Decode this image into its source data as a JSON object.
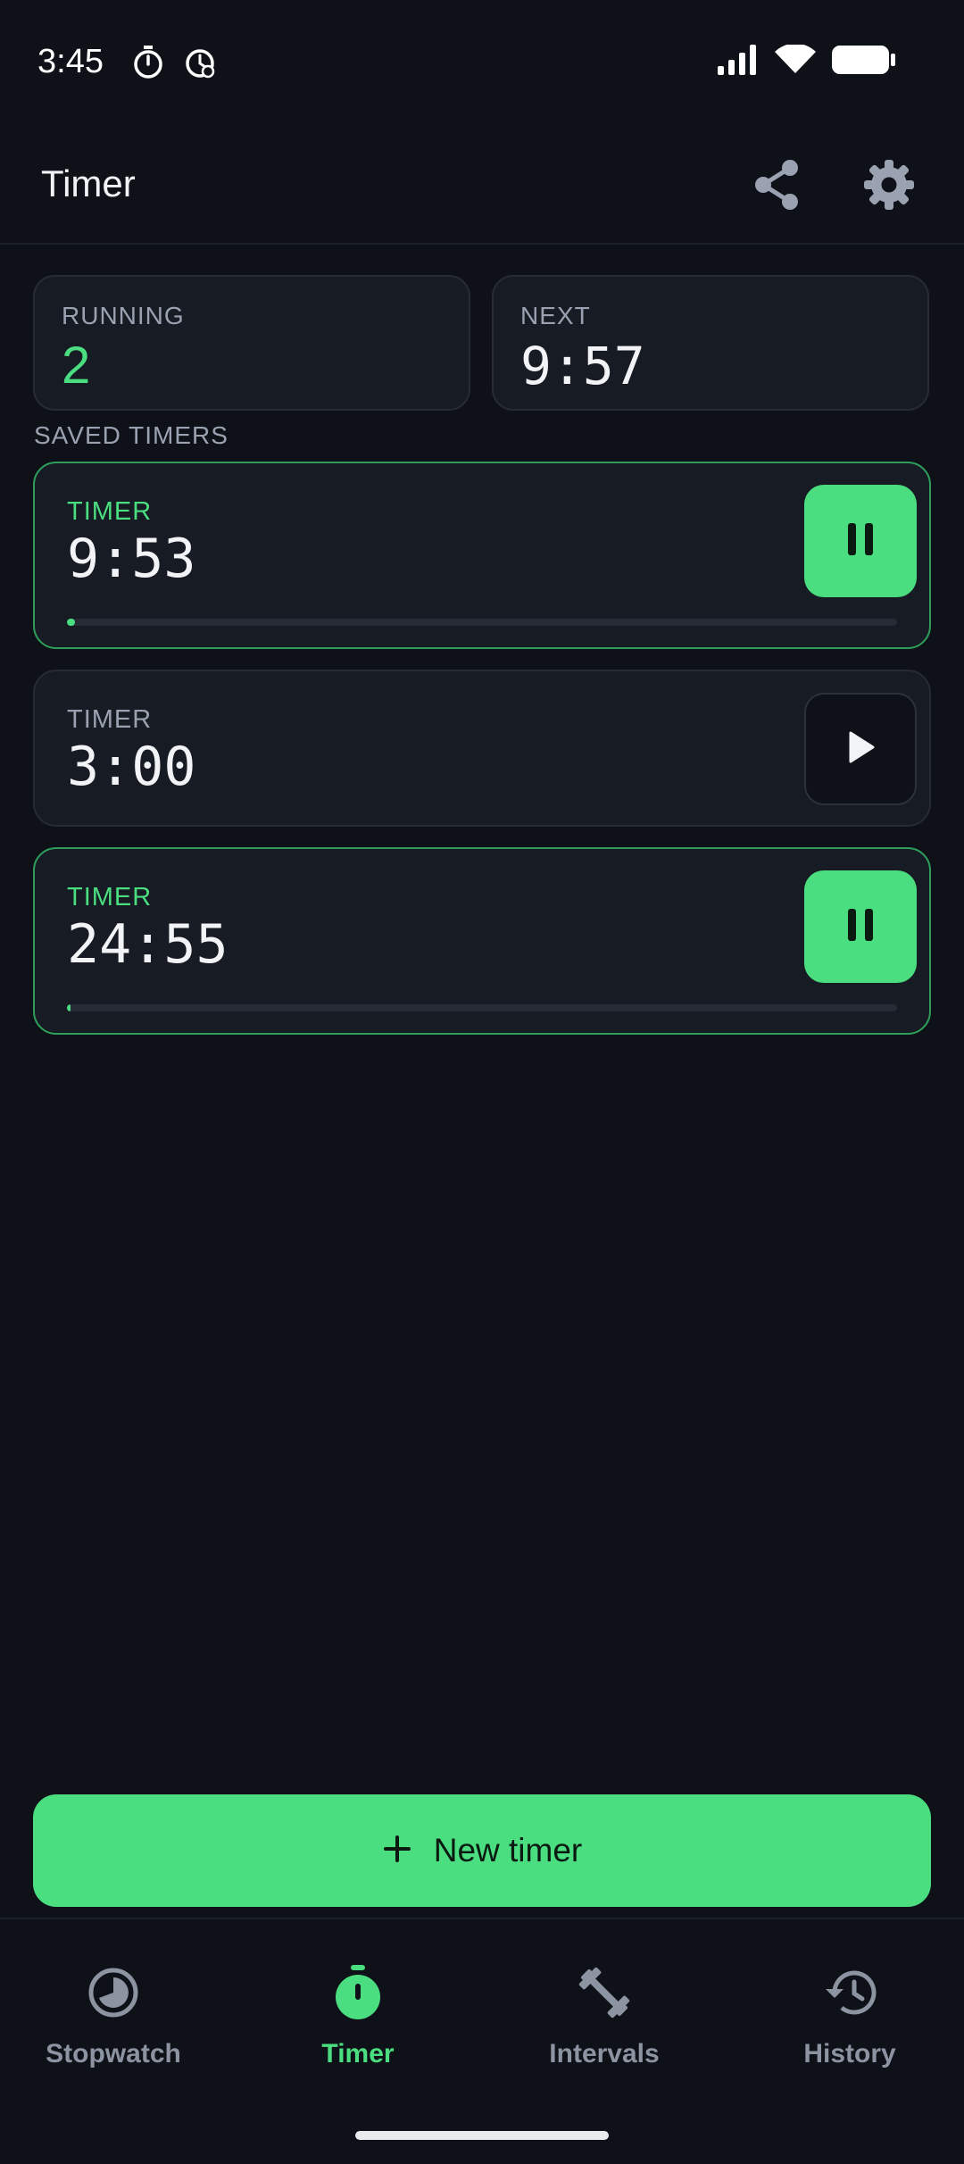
{
  "status_bar": {
    "time": "3:45",
    "left_icons": [
      "stopwatch-icon",
      "alarm-clock-icon"
    ],
    "right_icons": [
      "signal-icon",
      "wifi-icon",
      "battery-icon"
    ]
  },
  "app_bar": {
    "title": "Timer",
    "actions": [
      "share-icon",
      "gear-icon"
    ]
  },
  "stats": {
    "running_label": "RUNNING",
    "running_value": "2",
    "next_label": "NEXT",
    "next_value": "9:57"
  },
  "section_heading": "SAVED TIMERS",
  "timers": [
    {
      "label": "TIMER",
      "time": "9:53",
      "state": "running",
      "action_icon": "pause-icon",
      "progress": 0.01
    },
    {
      "label": "TIMER",
      "time": "3:00",
      "state": "idle",
      "action_icon": "play-icon"
    },
    {
      "label": "TIMER",
      "time": "24:55",
      "state": "running",
      "action_icon": "pause-icon",
      "progress": 0.003
    }
  ],
  "new_timer": {
    "label": "New timer",
    "icon": "plus-icon"
  },
  "bottom_nav": {
    "items": [
      {
        "label": "Stopwatch",
        "icon": "stopwatch-pie-icon",
        "active": false
      },
      {
        "label": "Timer",
        "icon": "timer-icon",
        "active": true
      },
      {
        "label": "Intervals",
        "icon": "dumbbell-icon",
        "active": false
      },
      {
        "label": "History",
        "icon": "history-icon",
        "active": false
      }
    ]
  },
  "colors": {
    "background": "#0e1118",
    "card": "#171b23",
    "accent": "#4ade80",
    "muted": "#9aa2b1"
  }
}
